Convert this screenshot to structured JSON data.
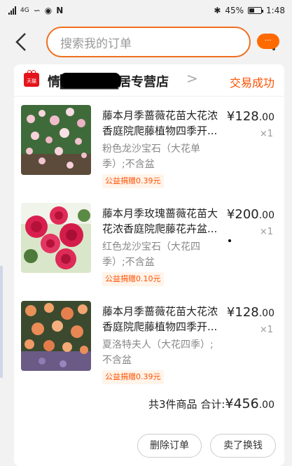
{
  "status_bar": {
    "network": "4G",
    "battery": "45%",
    "battery_level": 0.45,
    "time": "1:48"
  },
  "header": {
    "search_placeholder": "搜索我的订单",
    "bubble": "···"
  },
  "shop": {
    "badge": "天猫",
    "name": "情██████居专营店",
    "name_chevron": ">",
    "order_status": "交易成功"
  },
  "items": [
    {
      "title": "藤本月季蔷薇花苗大花浓香庭院爬藤植物四季开...",
      "sku": "粉色龙沙宝石（大花单季）;不含盆",
      "price": "¥128",
      "price_cents": ".00",
      "qty": "×1",
      "charity": "公益捐赠0.39元"
    },
    {
      "title": "藤本月季玫瑰蔷薇花苗大花浓香庭院爬藤花卉盆...",
      "sku": "红色龙沙宝石（大花四季）;不含盆",
      "price": "¥200",
      "price_cents": ".00",
      "qty": "×1",
      "charity": "公益捐赠0.10元"
    },
    {
      "title": "藤本月季蔷薇花苗大花浓香庭院爬藤植物四季开...",
      "sku": "夏洛特夫人（大花四季）;不含盆",
      "price": "¥128",
      "price_cents": ".00",
      "qty": "×1",
      "charity": "公益捐赠0.39元"
    }
  ],
  "summary": {
    "count_text": "共3件商品",
    "total_label": "合计:",
    "total": "¥456",
    "total_cents": ".00"
  },
  "actions": {
    "delete_order": "删除订单",
    "resell": "卖了换钱"
  },
  "colors": {
    "accent": "#ff5000",
    "search_border": "#ef6f1f"
  }
}
